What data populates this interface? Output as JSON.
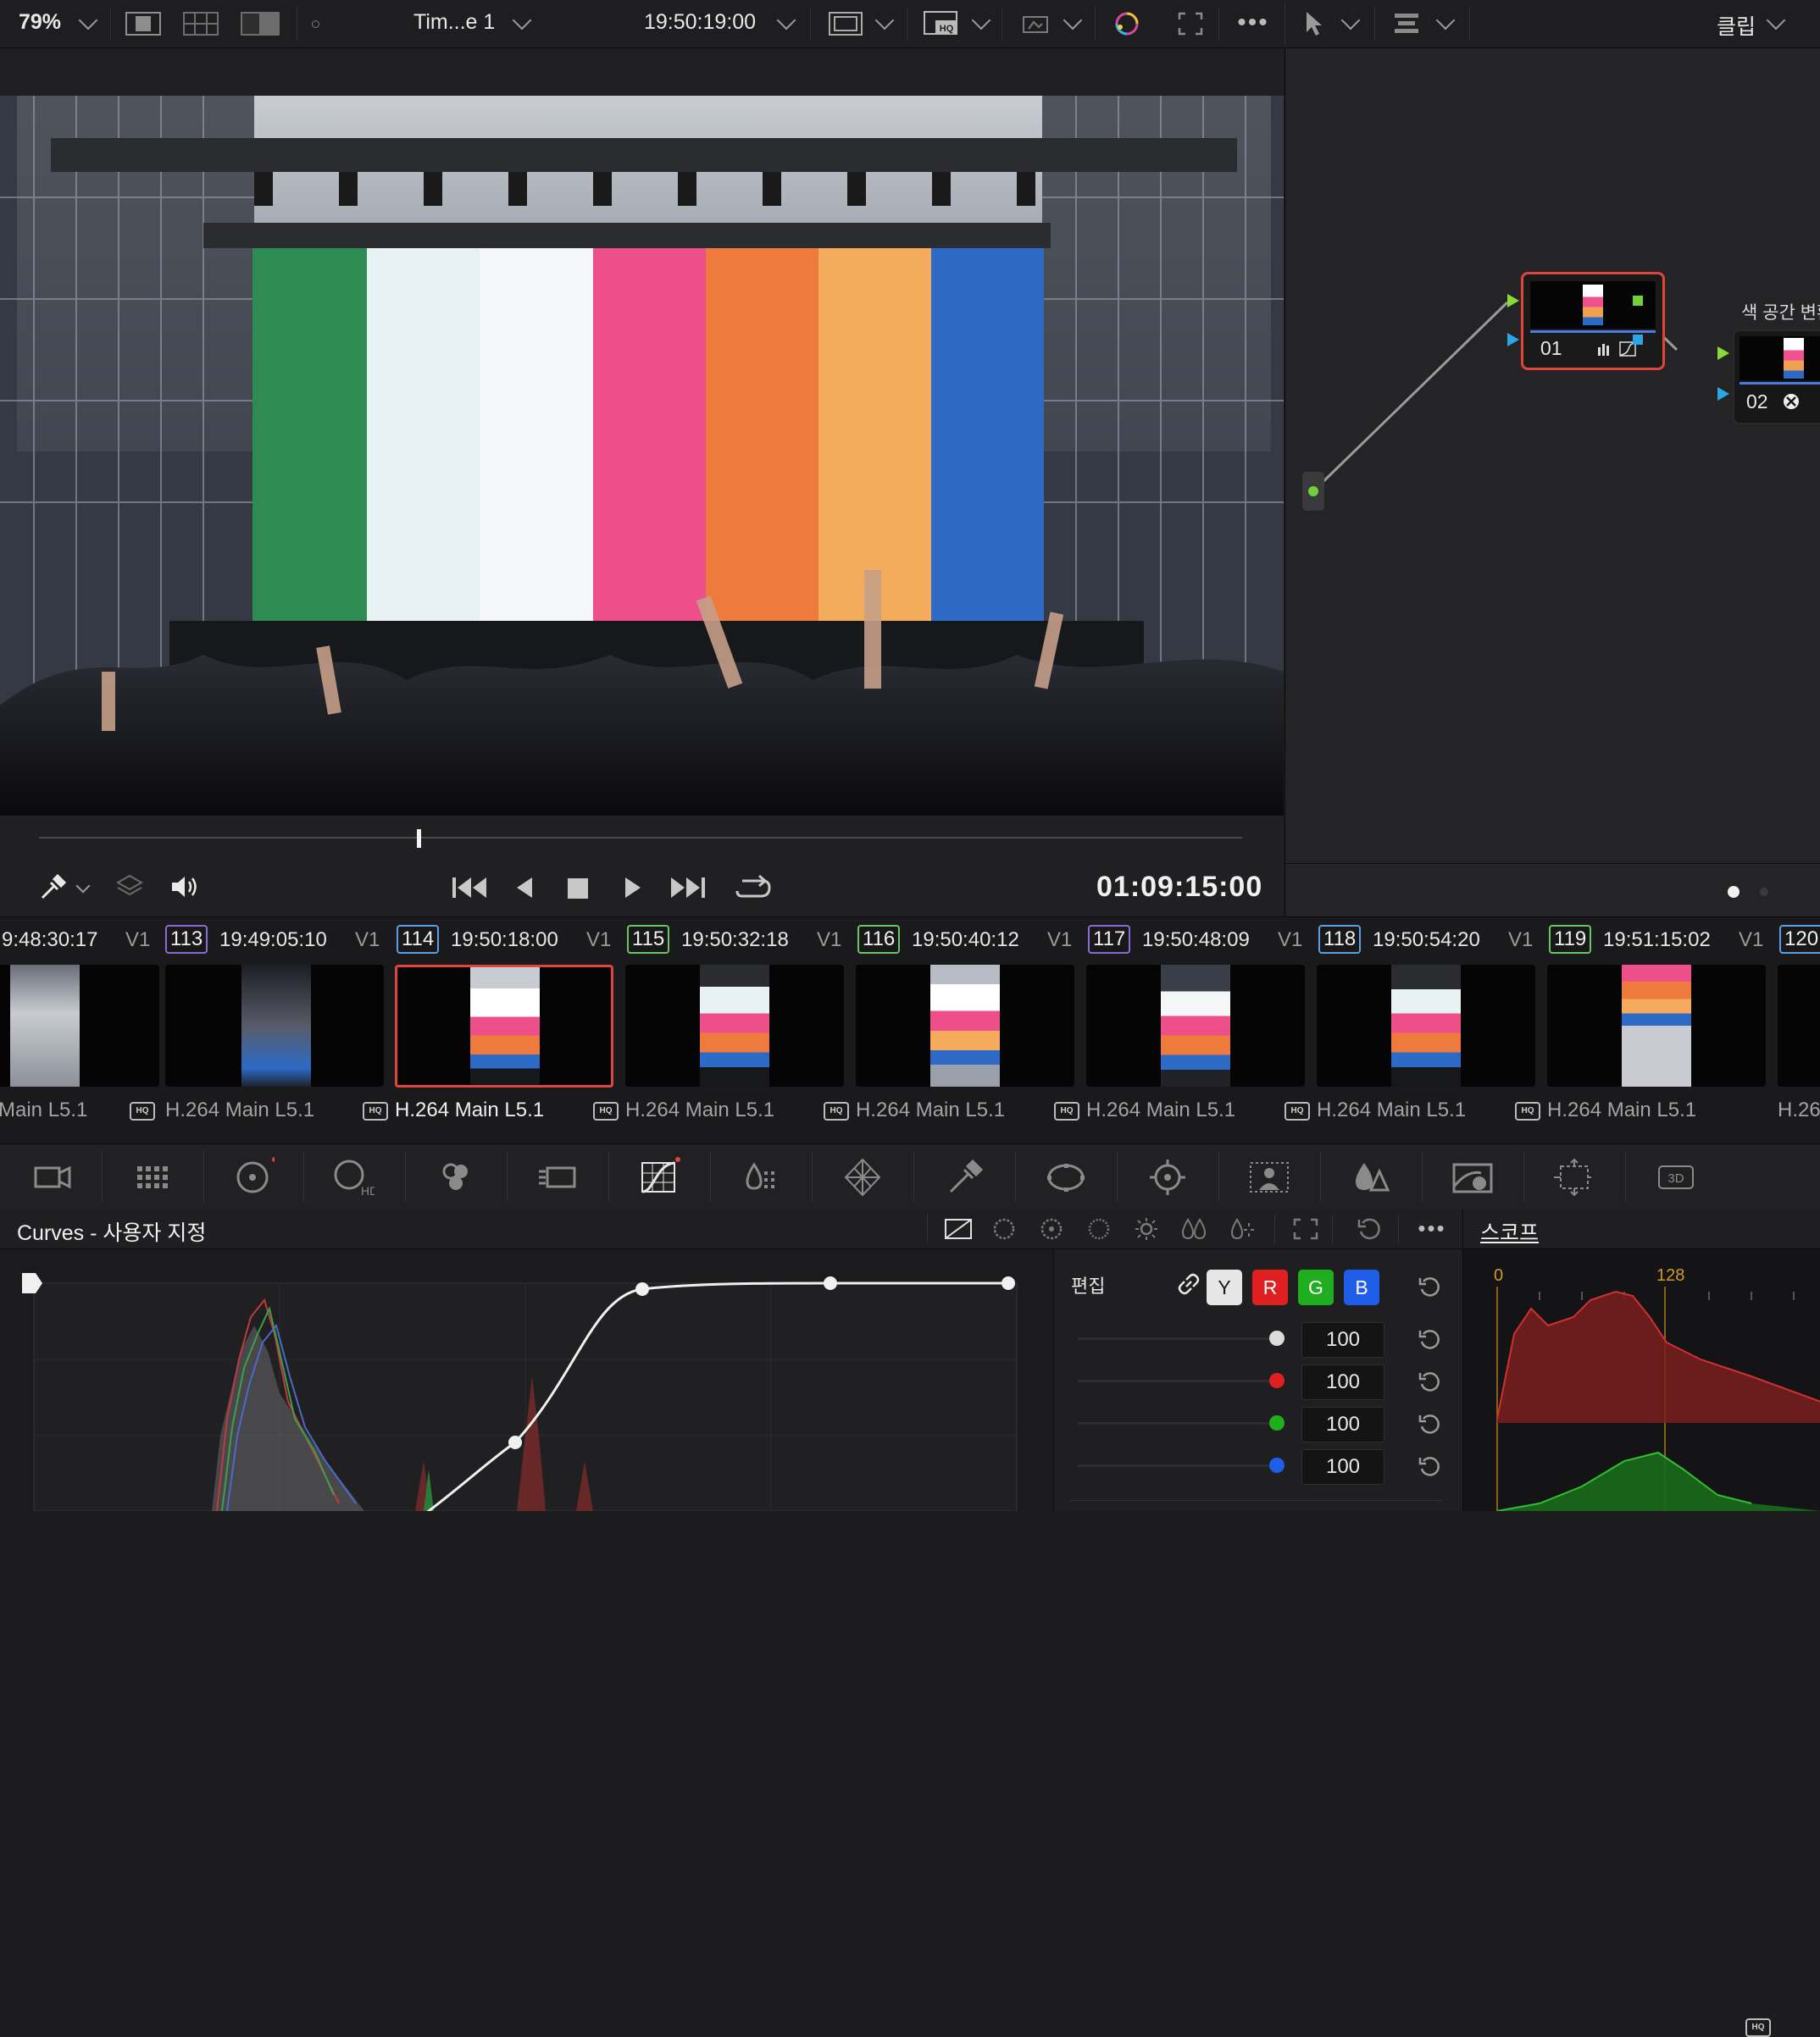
{
  "toolbar": {
    "zoom": "79%",
    "timeline_name": "Tim...e 1",
    "timecode": "19:50:19:00",
    "right_mode": "클립"
  },
  "viewer": {
    "playhead_timecode": "01:09:15:00",
    "playhead_fraction": 0.32
  },
  "nodes": {
    "node1": {
      "number": "01"
    },
    "node2": {
      "number": "02",
      "label": "색 공간 변환"
    }
  },
  "clips": [
    {
      "number": "",
      "timecode": "9:48:30:17",
      "track": "V1",
      "codec": "Main L5.1",
      "selected": false,
      "border": "#9a9a9a"
    },
    {
      "number": "113",
      "timecode": "19:49:05:10",
      "track": "V1",
      "codec": "H.264 Main L5.1",
      "selected": false,
      "border": "#8a6ad6"
    },
    {
      "number": "114",
      "timecode": "19:50:18:00",
      "track": "V1",
      "codec": "H.264 Main L5.1",
      "selected": true,
      "border": "#5aa0e6"
    },
    {
      "number": "115",
      "timecode": "19:50:32:18",
      "track": "V1",
      "codec": "H.264 Main L5.1",
      "selected": false,
      "border": "#6ac46a"
    },
    {
      "number": "116",
      "timecode": "19:50:40:12",
      "track": "V1",
      "codec": "H.264 Main L5.1",
      "selected": false,
      "border": "#6ac46a"
    },
    {
      "number": "117",
      "timecode": "19:50:48:09",
      "track": "V1",
      "codec": "H.264 Main L5.1",
      "selected": false,
      "border": "#8a6ad6"
    },
    {
      "number": "118",
      "timecode": "19:50:54:20",
      "track": "V1",
      "codec": "H.264 Main L5.1",
      "selected": false,
      "border": "#5aa0e6"
    },
    {
      "number": "119",
      "timecode": "19:51:15:02",
      "track": "V1",
      "codec": "H.264 Main L5.1",
      "selected": false,
      "border": "#6ac46a"
    },
    {
      "number": "120",
      "timecode": "",
      "track": "",
      "codec": "H.26",
      "selected": false,
      "border": "#5aa0e6"
    }
  ],
  "hq_badge": "HQ",
  "curves": {
    "title": "Curves - 사용자 지정",
    "edit_label": "편집",
    "channels": [
      "Y",
      "R",
      "G",
      "B"
    ],
    "intensity": [
      {
        "channel": "Y",
        "value": "100",
        "color": "#d8d8d8"
      },
      {
        "channel": "R",
        "value": "100",
        "color": "#e02020"
      },
      {
        "channel": "G",
        "value": "100",
        "color": "#1fae1f"
      },
      {
        "channel": "B",
        "value": "100",
        "color": "#1e5ee8"
      }
    ]
  },
  "scope": {
    "title": "스코프",
    "tick_0": "0",
    "tick_128": "128"
  },
  "palette_labels": {
    "hdr": "HDR",
    "three_d": "3D"
  },
  "colors": {
    "accent_selected": "#e0453a",
    "channel_y": "#dcdcdc",
    "channel_r": "#e02020",
    "channel_g": "#1fae1f",
    "channel_b": "#1e5ee8"
  }
}
